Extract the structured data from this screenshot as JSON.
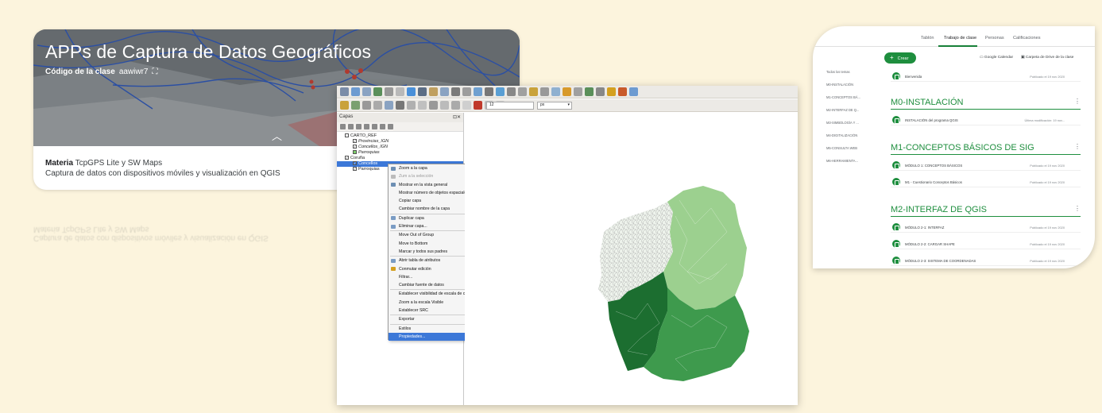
{
  "banner": {
    "title": "APPs de Captura de Datos Geográficos",
    "code_label": "Código de la clase",
    "code_value": "aawiwr7",
    "subject_label": "Materia",
    "subject_value": "TcpGPS Lite y SW Maps",
    "description": "Captura de datos con dispositivos móviles y visualización en QGIS"
  },
  "qgis": {
    "scale_value": "12",
    "scale_unit": "px",
    "layers_panel_title": "Capas",
    "layers": [
      {
        "label": "CARTO_REF",
        "indent": 1,
        "checked": false,
        "italic": false
      },
      {
        "label": "Provincias_IGN",
        "indent": 2,
        "checked": true,
        "italic": true,
        "swatch": "#ffffff"
      },
      {
        "label": "Concellos_IGN",
        "indent": 2,
        "checked": true,
        "italic": true,
        "swatch": "#ffffff"
      },
      {
        "label": "Parroquias",
        "indent": 2,
        "checked": false,
        "italic": true,
        "swatch": "#7ccf6a"
      },
      {
        "label": "Coruña",
        "indent": 1,
        "checked": true,
        "italic": false
      },
      {
        "label": "Concellos",
        "indent": 2,
        "checked": true,
        "italic": false,
        "selected": true
      },
      {
        "label": "Parroquias",
        "indent": 2,
        "checked": true,
        "italic": false
      }
    ],
    "context_menu": [
      {
        "label": "Zoom a la capa",
        "icon": "zoom-layer-icon"
      },
      {
        "label": "Zum a la selección",
        "disabled": true,
        "icon": "zoom-selection-icon"
      },
      {
        "label": "Mostrar en la vista general",
        "icon": "overview-icon"
      },
      {
        "label": "Mostrar número de objetos espaciales"
      },
      {
        "label": "Copiar capa"
      },
      {
        "label": "Cambiar nombre de la capa"
      },
      {
        "sep": true
      },
      {
        "label": "Duplicar capa",
        "icon": "duplicate-icon"
      },
      {
        "label": "Eliminar capa...",
        "icon": "delete-icon"
      },
      {
        "sep": true
      },
      {
        "label": "Move Out of Group"
      },
      {
        "label": "Move to Bottom"
      },
      {
        "label": "Marcar y todos sus padres"
      },
      {
        "sep": true
      },
      {
        "label": "Abrir tabla de atributos",
        "icon": "table-icon"
      },
      {
        "label": "Conmutar edición",
        "icon": "pencil-icon"
      },
      {
        "label": "Filtrar..."
      },
      {
        "label": "Cambiar fuente de datos"
      },
      {
        "sep": true
      },
      {
        "label": "Establecer visibilidad de escala de capas"
      },
      {
        "label": "Zoom a la escala Visible"
      },
      {
        "label": "Establecer SRC",
        "submenu": true
      },
      {
        "sep": true
      },
      {
        "label": "Exportar",
        "submenu": true
      },
      {
        "sep": true
      },
      {
        "label": "Estilos",
        "submenu": true
      },
      {
        "label": "Propiedades...",
        "highlighted": true
      }
    ]
  },
  "classwork": {
    "tabs": [
      "Tablón",
      "Trabajo de clase",
      "Personas",
      "Calificaciones"
    ],
    "active_tab": "Trabajo de clase",
    "create_label": "Crear",
    "calendar_link": "Google Calendar",
    "drive_link": "Carpeta de Drive de la clase",
    "sidebar": [
      "Todos los temas",
      "M0-INSTALACIÓN",
      "M1-CONCEPTOS BÁ...",
      "M2-INTERFAZ DE Q...",
      "M3-SIMBOLOGÍA Y ...",
      "M4-DIGITALIZACIÓN",
      "M5-CONSULTA WEB",
      "M6-HERRAMIENTA..."
    ],
    "welcome": {
      "title": "Bienvenida",
      "date": "Publicado el 19 nov 2020"
    },
    "topics": [
      {
        "title": "M0-INSTALACIÓN",
        "items": [
          {
            "title": "INSTALACIÓN del programa QGIS",
            "date": "Última modificación: 19 nov..."
          }
        ]
      },
      {
        "title": "M1-CONCEPTOS BÁSICOS DE SIG",
        "items": [
          {
            "title": "MÓDULO 1: CONCEPTOS BÁSICOS",
            "date": "Publicado el 19 nov 2020"
          },
          {
            "title": "M1 - Cuestionario Conceptos Básicos",
            "date": "Publicado el 19 nov 2020"
          }
        ]
      },
      {
        "title": "M2-INTERFAZ DE QGIS",
        "items": [
          {
            "title": "MÓDULO 2-1: INTERFAZ",
            "date": "Publicado el 19 nov 2020"
          },
          {
            "title": "MÓDULO 2-2: CARGAR SHAPE",
            "date": "Publicado el 19 nov 2020"
          },
          {
            "title": "MÓDULO 2-3: SISTEMA DE COORDENADAS",
            "date": "Publicado el 19 nov 2020"
          }
        ]
      }
    ]
  },
  "colors": {
    "classroom_green": "#1e8e3e",
    "qgis_selection": "#3c78d8",
    "background": "#fcf4dd"
  }
}
